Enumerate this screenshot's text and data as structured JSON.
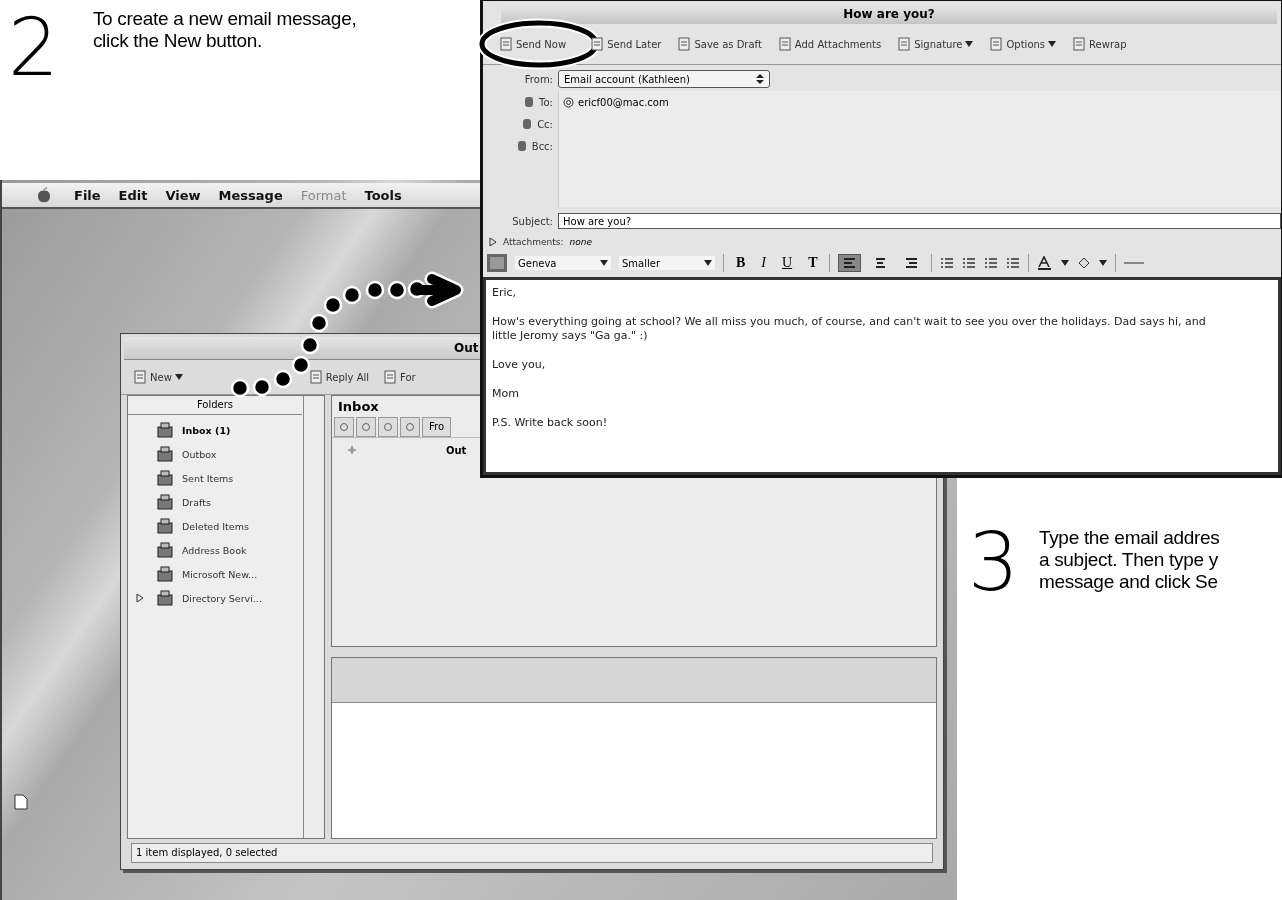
{
  "steps": [
    {
      "number": "2",
      "lines": [
        "To create a new email message,",
        "click the New button."
      ]
    },
    {
      "number": "3",
      "lines": [
        "Type the email addres",
        "a subject. Then type y",
        "message and click Se"
      ]
    }
  ],
  "desktop": {
    "menu_bar": [
      {
        "label": "File",
        "disabled": false
      },
      {
        "label": "Edit",
        "disabled": false
      },
      {
        "label": "View",
        "disabled": false
      },
      {
        "label": "Message",
        "disabled": false
      },
      {
        "label": "Format",
        "disabled": true
      },
      {
        "label": "Tools",
        "disabled": false
      }
    ]
  },
  "main_window": {
    "title": "Out",
    "toolbar": [
      {
        "label": "New",
        "kind": "menu"
      },
      {
        "label": "Reply All",
        "kind": "button"
      },
      {
        "label": "For",
        "kind": "button"
      }
    ],
    "folders_header": "Folders",
    "folders": [
      {
        "label": "Inbox (1)",
        "unread": true,
        "kind": "folder"
      },
      {
        "label": "Outbox",
        "unread": false,
        "kind": "folder"
      },
      {
        "label": "Sent Items",
        "unread": false,
        "kind": "folder"
      },
      {
        "label": "Drafts",
        "unread": false,
        "kind": "folder"
      },
      {
        "label": "Deleted Items",
        "unread": false,
        "kind": "folder"
      },
      {
        "label": "Address Book",
        "unread": false,
        "kind": "folder"
      },
      {
        "label": "Microsoft New...",
        "unread": false,
        "kind": "folder"
      },
      {
        "label": "Directory Servi...",
        "unread": false,
        "kind": "group"
      }
    ],
    "inbox_title": "Inbox",
    "column_label": "Fro",
    "messages": [
      {
        "from": "Out",
        "unread": true
      }
    ],
    "status_bar": "1 item displayed, 0 selected"
  },
  "compose_window": {
    "title": "How are you?",
    "toolbar": [
      {
        "label": "Send Now",
        "kind": "button",
        "highlighted": true
      },
      {
        "label": "Send Later",
        "kind": "button",
        "highlighted": false
      },
      {
        "label": "Save as Draft",
        "kind": "button",
        "highlighted": false
      },
      {
        "label": "Add Attachments",
        "kind": "button",
        "highlighted": false
      },
      {
        "label": "Signature",
        "kind": "menu",
        "highlighted": false
      },
      {
        "label": "Options",
        "kind": "menu",
        "highlighted": false
      },
      {
        "label": "Rewrap",
        "kind": "button",
        "highlighted": false
      }
    ],
    "from_label": "From:",
    "from_value": "Email account (Kathleen)",
    "recipients": [
      {
        "label": "To:",
        "value": "ericf00@mac.com"
      },
      {
        "label": "Cc:"
      },
      {
        "label": "Bcc:"
      }
    ],
    "subject_label": "Subject:",
    "subject": "How are you?",
    "attachments_label": "Attachments:",
    "attachments_value": "none",
    "font": "Geneva",
    "size": "Smaller",
    "styles": [
      {
        "label": "B",
        "kind": "bold"
      },
      {
        "label": "I",
        "kind": "italic"
      },
      {
        "label": "U",
        "kind": "underline"
      },
      {
        "label": "T",
        "kind": "plain"
      }
    ],
    "alignment": [
      {
        "selected": true
      },
      {
        "selected": false
      },
      {
        "selected": false
      }
    ],
    "body": [
      "Eric,",
      "How's everything going at school? We all miss you much, of course, and can't wait to see you over the holidays. Dad says hi, and little Jeromy says \"Ga ga.\" :)",
      "Love you,",
      "Mom",
      "P.S. Write back soon!"
    ]
  }
}
